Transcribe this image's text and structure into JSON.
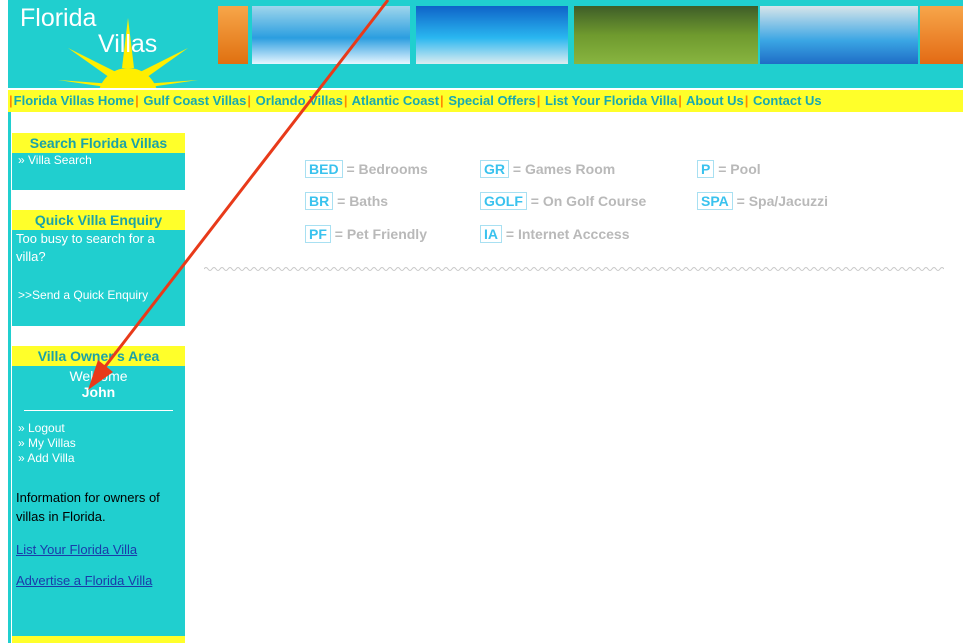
{
  "logo": {
    "line1": "Florida",
    "line2": "Villas"
  },
  "nav": {
    "items": [
      "Florida Villas Home",
      "Gulf Coast Villas",
      "Orlando Villas",
      "Atlantic Coast",
      "Special Offers",
      "List Your Florida Villa",
      "About Us",
      "Contact Us"
    ]
  },
  "search_box": {
    "title": "Search Florida Villas",
    "link": "» Villa Search"
  },
  "enquiry_box": {
    "title": "Quick Villa Enquiry",
    "text": "Too busy to search for a villa?",
    "link": ">>Send a Quick Enquiry"
  },
  "owners_box": {
    "title": "Villa Owner's Area",
    "welcome": "Welcome",
    "user": "John",
    "links": [
      "» Logout",
      "» My Villas",
      "» Add Villa"
    ],
    "info": "Information for owners of villas in Florida.",
    "list_link": "List Your Florida Villa",
    "advertise_link": "Advertise a Florida Villa"
  },
  "legend": [
    {
      "code": "BED",
      "label": "= Bedrooms"
    },
    {
      "code": "GR",
      "label": "= Games Room"
    },
    {
      "code": "P",
      "label": "= Pool"
    },
    {
      "code": "BR",
      "label": "= Baths"
    },
    {
      "code": "GOLF",
      "label": "= On Golf Course"
    },
    {
      "code": "SPA",
      "label": "= Spa/Jacuzzi"
    },
    {
      "code": "PF",
      "label": "= Pet Friendly"
    },
    {
      "code": "IA",
      "label": "= Internet Acccess"
    }
  ],
  "colors": {
    "teal": "#20cfcf",
    "yellow": "#ffff2a",
    "arrow": "#e83a1a",
    "nav_text": "#1aa2a8"
  }
}
